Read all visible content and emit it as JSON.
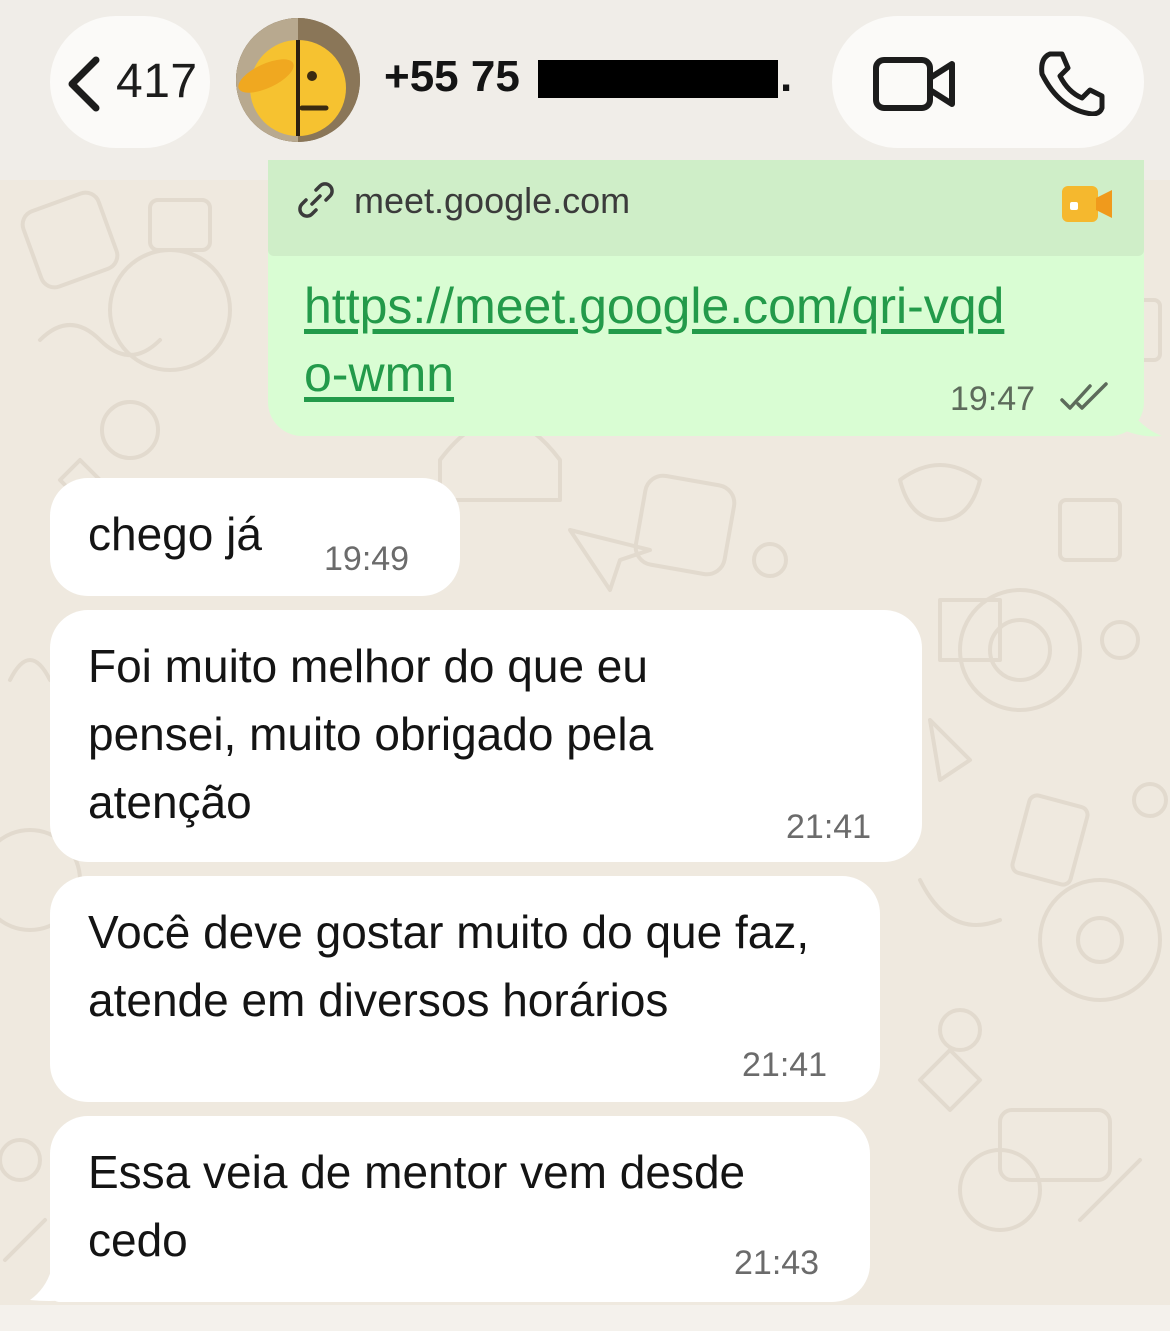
{
  "header": {
    "back_count": "417",
    "contact_name": "+55 75",
    "redaction_suffix": ".",
    "icons": {
      "back": "chevron-left-icon",
      "video": "video-camera-icon",
      "phone": "phone-icon"
    }
  },
  "messages": {
    "outgoing_link": {
      "preview_domain": "meet.google.com",
      "url": "https://meet.google.com/qri-vqdo-wmn",
      "time": "19:47",
      "status": "read",
      "icons": {
        "link": "link-icon",
        "meet": "google-meet-icon",
        "status": "double-check-icon"
      }
    },
    "incoming": [
      {
        "text": "chego já",
        "time": "19:49"
      },
      {
        "text": "Foi muito melhor do que eu pensei, muito obrigado pela atenção",
        "time": "21:41"
      },
      {
        "text": "Você deve gostar muito do que faz, atende em diversos horários",
        "time": "21:41"
      },
      {
        "text": "Essa veia de mentor vem desde cedo",
        "time": "21:43"
      }
    ]
  },
  "colors": {
    "outgoing_bubble": "#d9fdd3",
    "incoming_bubble": "#ffffff",
    "link": "#239a4a",
    "chat_background": "#efe9df"
  }
}
